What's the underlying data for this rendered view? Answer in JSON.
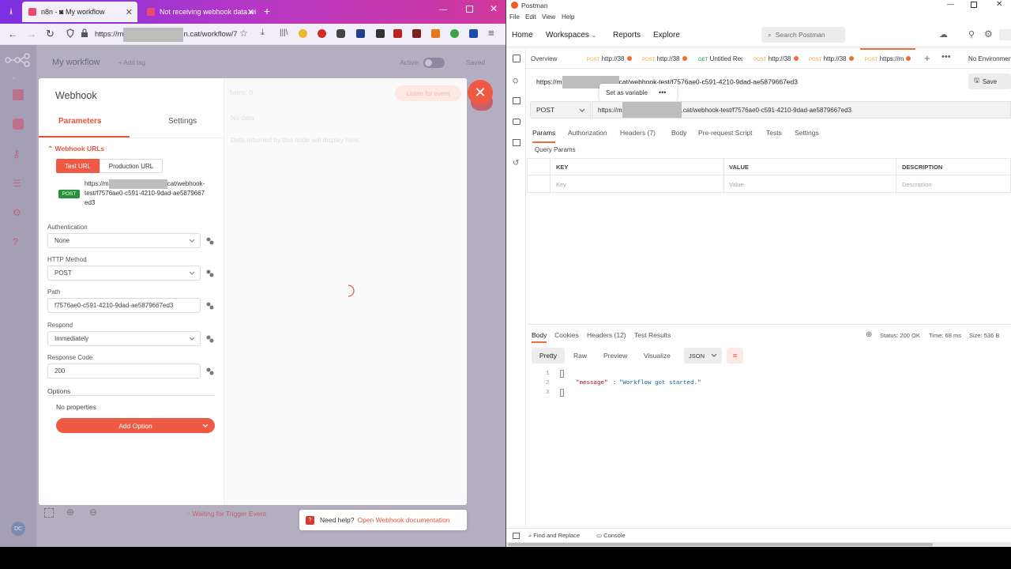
{
  "firefox": {
    "tab1_title": "n8n - ◙ My workflow",
    "tab2_title": "Not receiving webhook data wi",
    "url_prefix": "https://m",
    "url_suffix": "n.cat/workflow/7"
  },
  "n8n": {
    "workflow_name": "My workflow",
    "add_tag": "+ Add tag",
    "active_label": "Active:",
    "saved_label": "Saved",
    "avatar_initials": "DC",
    "waiting_text": "Waiting for Trigger Event"
  },
  "node": {
    "title": "Webhook",
    "tab_parameters": "Parameters",
    "tab_settings": "Settings",
    "webhook_urls_label": "Webhook URLs",
    "test_url_btn": "Test URL",
    "prod_url_btn": "Production URL",
    "method_badge": "POST",
    "url_line1_prefix": "https://m",
    "url_line1_suffix": "cat/webhook-",
    "url_line2": "test/f7576ae0-c591-4210-9dad-ae5879667",
    "url_line3": "ed3",
    "auth_label": "Authentication",
    "auth_value": "None",
    "method_label": "HTTP Method",
    "method_value": "POST",
    "path_label": "Path",
    "path_value": "f7576ae0-c591-4210-9dad-ae5879667ed3",
    "respond_label": "Respond",
    "respond_value": "Immediately",
    "rcode_label": "Response Code",
    "rcode_value": "200",
    "options_label": "Options",
    "no_props": "No properties",
    "add_option": "Add Option",
    "items_label": "Items: 0",
    "listen_btn": "Listen for event",
    "no_data": "No data",
    "data_hint": "Data returned by this node will display here."
  },
  "help": {
    "text": "Need help?",
    "link": "Open Webhook documentation"
  },
  "postman": {
    "app_title": "Postman",
    "menu": [
      "File",
      "Edit",
      "View",
      "Help"
    ],
    "nav": [
      "Home",
      "Workspaces",
      "Reports",
      "Explore"
    ],
    "search_placeholder": "Search Postman",
    "tabs": [
      {
        "method": "",
        "label": "Overview"
      },
      {
        "method": "POST",
        "label": "http://38"
      },
      {
        "method": "POST",
        "label": "http://38"
      },
      {
        "method": "GET",
        "label": "Untitled Req"
      },
      {
        "method": "POST",
        "label": "http://38"
      },
      {
        "method": "POST",
        "label": "http://38"
      },
      {
        "method": "POST",
        "label": "https://m"
      }
    ],
    "env_label": "No Environment",
    "req_name_prefix": "https://m",
    "req_name_suffix": "cat/webhook-test/f7576ae0-c591-4210-9dad-ae5879667ed3",
    "save_label": "Save",
    "set_variable": "Set as variable",
    "method": "POST",
    "url_prefix": "https://m",
    "url_suffix": ".cat/webhook-test/f7576ae0-c591-4210-9dad-ae5879667ed3",
    "req_tabs": [
      "Params",
      "Authorization",
      "Headers (7)",
      "Body",
      "Pre-request Script",
      "Tests",
      "Settings"
    ],
    "query_params_label": "Query Params",
    "col_key": "KEY",
    "col_value": "VALUE",
    "col_desc": "DESCRIPTION",
    "ph_key": "Key",
    "ph_value": "Value",
    "ph_desc": "Description",
    "resp_tabs": [
      "Body",
      "Cookies",
      "Headers (12)",
      "Test Results"
    ],
    "status": "Status: 200 OK",
    "time": "Time: 68 ms",
    "size": "Size: 536 B",
    "view_tabs": [
      "Pretty",
      "Raw",
      "Preview",
      "Visualize"
    ],
    "format": "JSON",
    "code_lines": [
      "1",
      "2",
      "3"
    ],
    "code_key": "\"message\"",
    "code_value": "\"Workflow got started.\"",
    "find_replace": "Find and Replace",
    "console": "Console"
  }
}
